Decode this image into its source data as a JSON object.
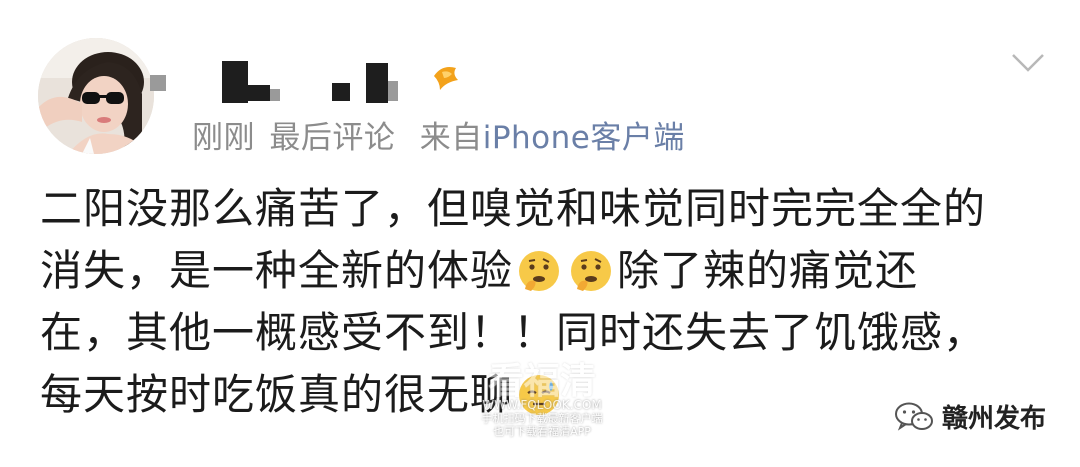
{
  "post": {
    "meta": {
      "time": "刚刚",
      "tag": "最后评论",
      "from_label": "来自",
      "client": "iPhone客户端"
    },
    "content": {
      "line1": "二阳没那么痛苦了，但嗅觉和味觉同时完完全全的",
      "line2a": "消失，是一种全新的体验",
      "line2b": "除了辣的痛觉还",
      "line3": "在，其他一概感受不到！！同时还失去了饥饿感，",
      "line4": "每天按时吃饭真的很无聊"
    },
    "icons": {
      "avatar": "profile-photo",
      "badge": "gold-fish-badge-icon",
      "chevron": "chevron-down-icon",
      "emoji_thinking": "thinking-face-emoji",
      "emoji_sweat": "downcast-sweat-face-emoji",
      "wechat": "wechat-icon"
    }
  },
  "watermark": {
    "title": "看福清",
    "url": "WWW.FQLOOK.COM",
    "line1": "手机扫码下载最新客户端",
    "line2": "也可下载看福清APP"
  },
  "source": {
    "label": "赣州发布"
  }
}
